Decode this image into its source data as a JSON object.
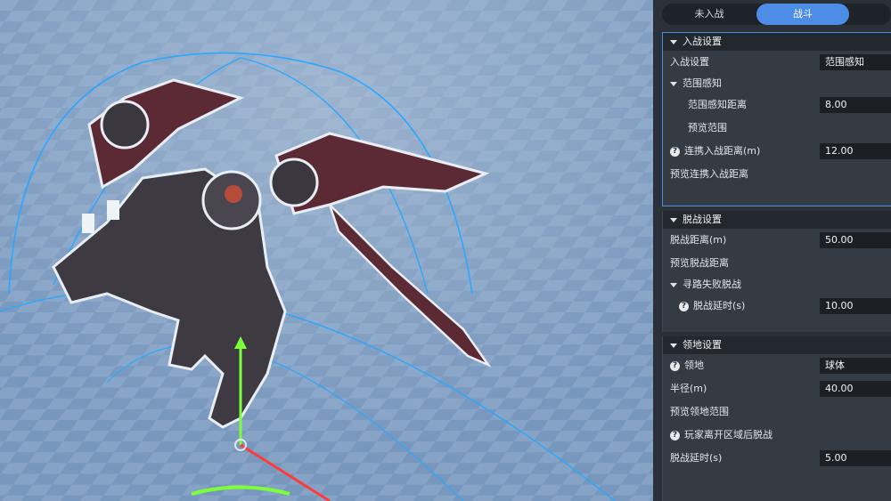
{
  "tabs": [
    {
      "label": "未入战"
    },
    {
      "label": "战斗"
    }
  ],
  "sections": {
    "enter_battle": {
      "title": "入战设置",
      "enter_setting_label": "入战设置",
      "enter_setting_value": "范围感知",
      "range_sense_group": "范围感知",
      "range_sense_distance_label": "范围感知距离",
      "range_sense_distance_value": "8.00",
      "preview_range_label": "预览范围",
      "chain_distance_label": "连携入战距离(m)",
      "chain_distance_value": "12.00",
      "preview_chain_label": "预览连携入战距离"
    },
    "leave_battle": {
      "title": "脱战设置",
      "distance_label": "脱战距离(m)",
      "distance_value": "50.00",
      "preview_distance_label": "预览脱战距离",
      "pathfail_group": "寻路失败脱战",
      "timeout_label": "脱战延时(s)",
      "timeout_value": "10.00"
    },
    "territory": {
      "title": "领地设置",
      "territory_label": "领地",
      "territory_value": "球体",
      "radius_label": "半径(m)",
      "radius_value": "40.00",
      "preview_label": "预览领地范围",
      "player_leave_label": "玩家离开区域后脱战",
      "delay_label": "脱战延时(s)",
      "delay_value": "5.00"
    }
  },
  "colors": {
    "accent": "#4d8de6",
    "panel_bg": "#2b3138",
    "gizmo_blue": "#2aa8ff",
    "gizmo_green": "#7cff3a",
    "gizmo_red": "#ff3a3a"
  },
  "icons": {
    "help": "?"
  }
}
